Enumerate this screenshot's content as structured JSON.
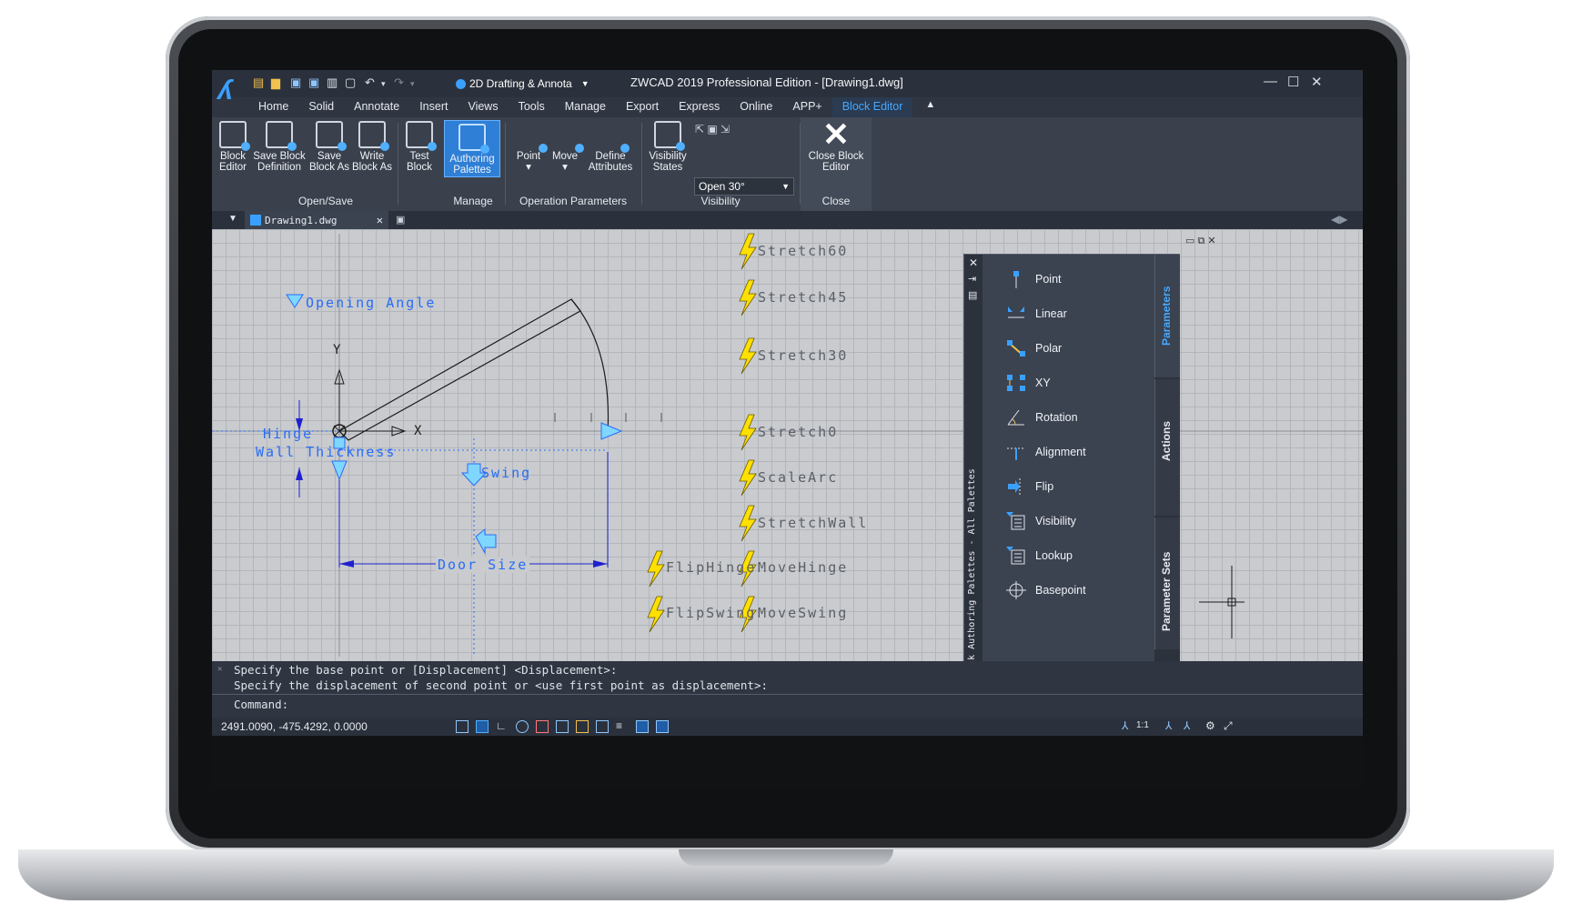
{
  "app": {
    "title": "ZWCAD 2019 Professional Edition - [Drawing1.dwg]",
    "workspace": "2D Drafting & Annota",
    "window_controls": [
      "—",
      "☐",
      "✕"
    ]
  },
  "menu": {
    "items": [
      "Home",
      "Solid",
      "Annotate",
      "Insert",
      "Views",
      "Tools",
      "Manage",
      "Export",
      "Express",
      "Online",
      "APP+",
      "Block Editor"
    ],
    "active": "Block Editor"
  },
  "ribbon": {
    "buttons": [
      {
        "line1": "Block",
        "line2": "Editor"
      },
      {
        "line1": "Save Block",
        "line2": "Definition"
      },
      {
        "line1": "Save",
        "line2": "Block As"
      },
      {
        "line1": "Write",
        "line2": "Block As"
      },
      {
        "line1": "Test",
        "line2": "Block"
      },
      {
        "line1": "Authoring",
        "line2": "Palettes"
      },
      {
        "line1": "Point",
        "line2": "▾"
      },
      {
        "line1": "Move",
        "line2": "▾"
      },
      {
        "line1": "Define",
        "line2": "Attributes"
      },
      {
        "line1": "Visibility",
        "line2": "States"
      },
      {
        "line1": "Close Block",
        "line2": "Editor"
      }
    ],
    "visibility_combo": "Open 30°",
    "groups": [
      "Open/Save",
      "Manage",
      "Operation Parameters",
      "Visibility",
      "Close"
    ]
  },
  "document_tab": "Drawing1.dwg",
  "canvas": {
    "labels": {
      "opening_angle": "Opening Angle",
      "hinge": "Hinge",
      "wall_thickness": "Wall Thickness",
      "swing": "Swing",
      "door_size": "Door Size",
      "axis_y": "Y",
      "axis_x": "X"
    },
    "actions": [
      "Stretch60",
      "Stretch45",
      "Stretch30",
      "Stretch0",
      "ScaleArc",
      "StretchWall",
      "FlipHinge",
      "MoveHinge",
      "FlipSwing",
      "MoveSwing"
    ]
  },
  "palette": {
    "title": "Block Authoring Palettes - All Palettes",
    "items": [
      "Point",
      "Linear",
      "Polar",
      "XY",
      "Rotation",
      "Alignment",
      "Flip",
      "Visibility",
      "Lookup",
      "Basepoint"
    ],
    "tabs": [
      "Parameters",
      "Actions",
      "Parameter Sets"
    ]
  },
  "command": {
    "lines": [
      "Specify the base point or [Displacement] <Displacement>:",
      "Specify the displacement of second point or <use first point as displacement>:",
      "Command:"
    ]
  },
  "status": {
    "coords": "2491.0090, -475.4292, 0.0000",
    "scale": "1:1"
  },
  "colors": {
    "accent": "#46a8ff",
    "parameter_blue": "#2a6cf5",
    "action_yellow": "#ffe000",
    "grip_cyan": "#7fd6ff"
  }
}
